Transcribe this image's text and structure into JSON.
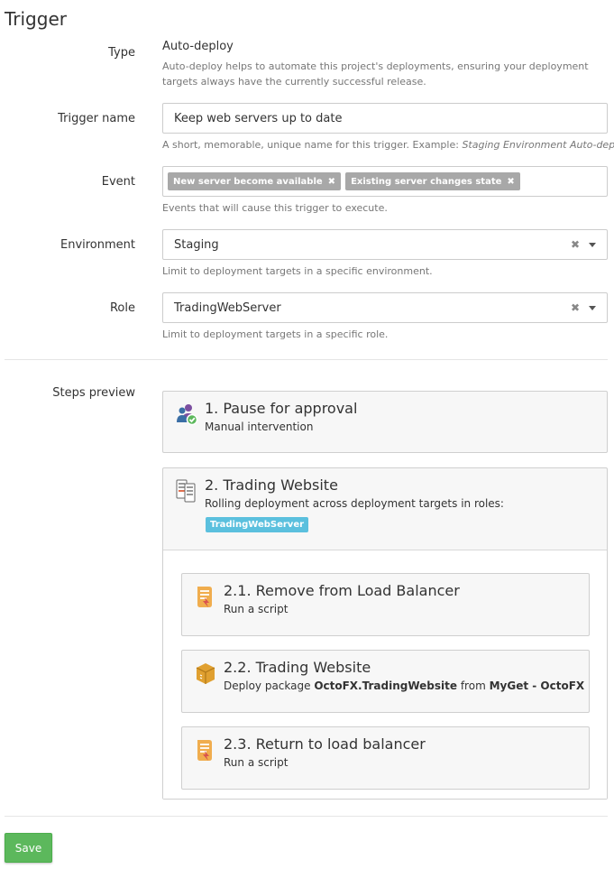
{
  "page": {
    "title": "Trigger"
  },
  "form": {
    "type": {
      "label": "Type",
      "value": "Auto-deploy",
      "help": "Auto-deploy helps to automate this project's deployments, ensuring your deployment targets always have the currently successful release."
    },
    "trigger_name": {
      "label": "Trigger name",
      "value": "Keep web servers up to date",
      "help_prefix": "A short, memorable, unique name for this trigger. Example: ",
      "help_example": "Staging Environment Auto-deploy"
    },
    "event": {
      "label": "Event",
      "tags": [
        "New server become available",
        "Existing server changes state"
      ],
      "help": "Events that will cause this trigger to execute."
    },
    "environment": {
      "label": "Environment",
      "value": "Staging",
      "help": "Limit to deployment targets in a specific environment."
    },
    "role": {
      "label": "Role",
      "value": "TradingWebServer",
      "help": "Limit to deployment targets in a specific role."
    }
  },
  "steps_preview": {
    "label": "Steps preview",
    "steps": [
      {
        "title": "1. Pause for approval",
        "subtitle": "Manual intervention",
        "icon": "manual-intervention-icon"
      },
      {
        "title": "2. Trading Website",
        "subtitle": "Rolling deployment across deployment targets in roles:",
        "role_badge": "TradingWebServer",
        "icon": "rolling-deployment-icon",
        "children": [
          {
            "title": "2.1. Remove from Load Balancer",
            "subtitle": "Run a script",
            "icon": "script-icon"
          },
          {
            "title": "2.2. Trading Website",
            "subtitle_prefix": "Deploy package ",
            "package": "OctoFX.TradingWebsite",
            "subtitle_mid": " from ",
            "feed": "MyGet - OctoFX",
            "icon": "package-icon"
          },
          {
            "title": "2.3. Return to load balancer",
            "subtitle": "Run a script",
            "icon": "script-icon"
          }
        ]
      }
    ]
  },
  "actions": {
    "save_label": "Save"
  },
  "colors": {
    "save_button": "#5cb85c",
    "role_badge": "#5bc0de",
    "tag": "#a8a8a8",
    "script_icon": "#f0ad4e",
    "package_icon": "#e0a030",
    "approval_check": "#5cb85c"
  }
}
